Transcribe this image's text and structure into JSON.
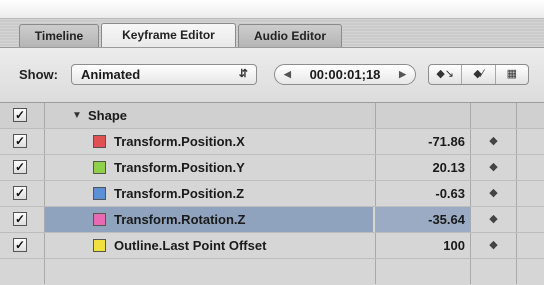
{
  "tabs": [
    {
      "label": "Timeline",
      "active": false
    },
    {
      "label": "Keyframe Editor",
      "active": true
    },
    {
      "label": "Audio Editor",
      "active": false
    }
  ],
  "toolbar": {
    "show_label": "Show:",
    "show_value": "Animated",
    "timecode": "00:00:01;18",
    "buttons": [
      "add-keyframe-icon",
      "curve-edit-icon",
      "fit-view-icon"
    ]
  },
  "group": {
    "label": "Shape",
    "expanded": true,
    "checked": true
  },
  "rows": [
    {
      "label": "Transform.Position.X",
      "value": "-71.86",
      "color": "#e05252",
      "checked": true,
      "selected": false
    },
    {
      "label": "Transform.Position.Y",
      "value": "20.13",
      "color": "#8fd04a",
      "checked": true,
      "selected": false
    },
    {
      "label": "Transform.Position.Z",
      "value": "-0.63",
      "color": "#5b8fd6",
      "checked": true,
      "selected": false
    },
    {
      "label": "Transform.Rotation.Z",
      "value": "-35.64",
      "color": "#e86ab3",
      "checked": true,
      "selected": true
    },
    {
      "label": "Outline.Last Point Offset",
      "value": "100",
      "color": "#f0e040",
      "checked": true,
      "selected": false
    }
  ]
}
